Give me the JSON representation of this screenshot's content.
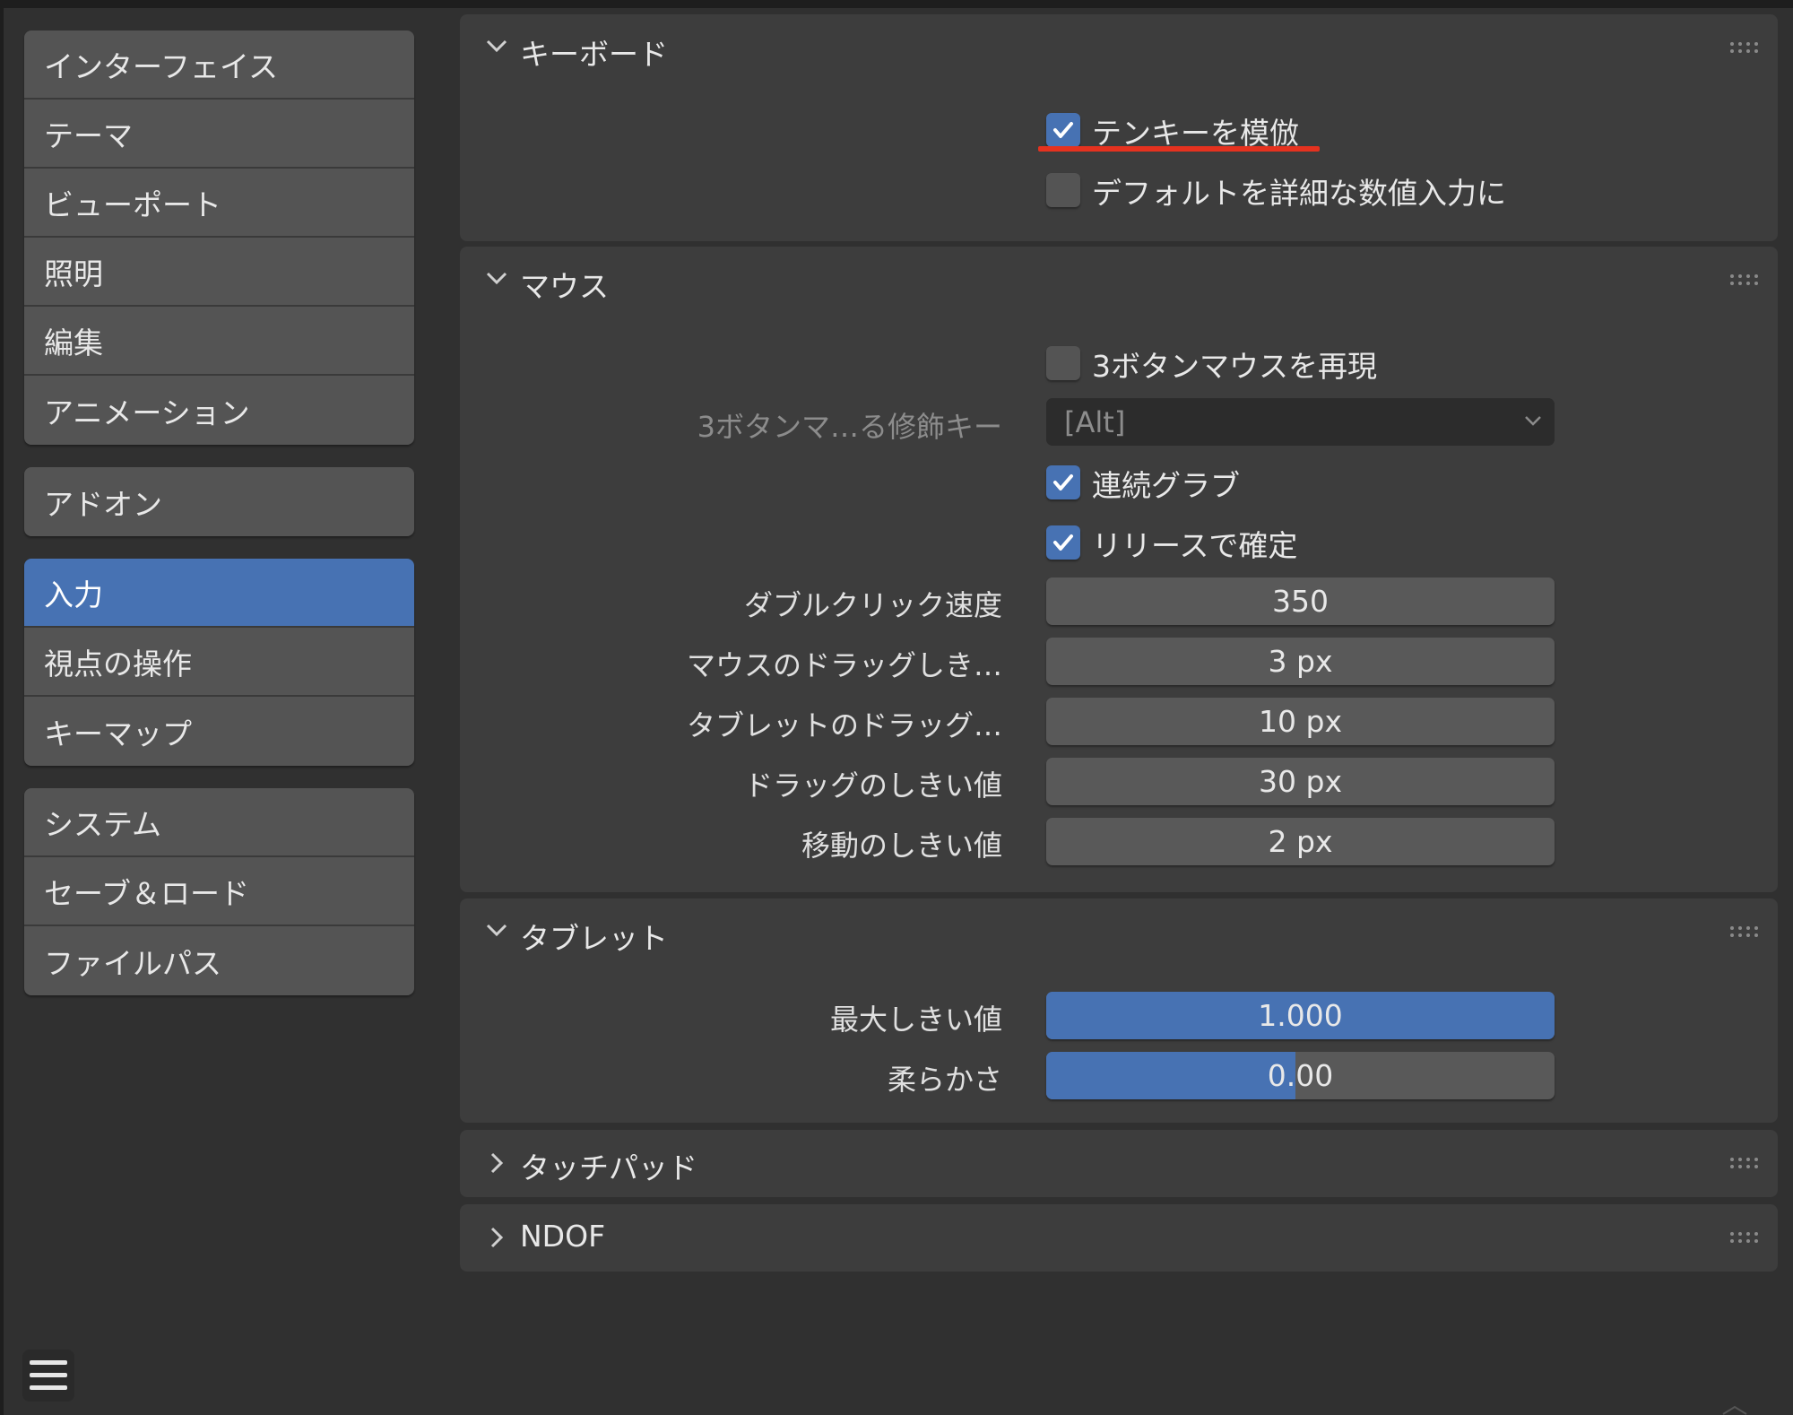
{
  "sidebar": {
    "groups": [
      [
        {
          "label": "インターフェイス",
          "active": false
        },
        {
          "label": "テーマ",
          "active": false
        },
        {
          "label": "ビューポート",
          "active": false
        },
        {
          "label": "照明",
          "active": false
        },
        {
          "label": "編集",
          "active": false
        },
        {
          "label": "アニメーション",
          "active": false
        }
      ],
      [
        {
          "label": "アドオン",
          "active": false
        }
      ],
      [
        {
          "label": "入力",
          "active": true
        },
        {
          "label": "視点の操作",
          "active": false
        },
        {
          "label": "キーマップ",
          "active": false
        }
      ],
      [
        {
          "label": "システム",
          "active": false
        },
        {
          "label": "セーブ＆ロード",
          "active": false
        },
        {
          "label": "ファイルパス",
          "active": false
        }
      ]
    ]
  },
  "keyboard": {
    "title": "キーボード",
    "emulate_numpad": {
      "label": "テンキーを模倣",
      "checked": true
    },
    "default_detailed_numeric": {
      "label": "デフォルトを詳細な数値入力に",
      "checked": false
    }
  },
  "mouse": {
    "title": "マウス",
    "emulate_3_button": {
      "label": "3ボタンマウスを再現",
      "checked": false
    },
    "emulate_modifier": {
      "label": "3ボタンマ…る修飾キー",
      "value": "[Alt]"
    },
    "continuous_grab": {
      "label": "連続グラブ",
      "checked": true
    },
    "release_confirm": {
      "label": "リリースで確定",
      "checked": true
    },
    "double_click": {
      "label": "ダブルクリック速度",
      "value": "350"
    },
    "mouse_drag": {
      "label": "マウスのドラッグしき…",
      "value": "3 px"
    },
    "tablet_drag": {
      "label": "タブレットのドラッグ…",
      "value": "10 px"
    },
    "drag_threshold": {
      "label": "ドラッグのしきい値",
      "value": "30 px"
    },
    "move_threshold": {
      "label": "移動のしきい値",
      "value": "2 px"
    }
  },
  "tablet": {
    "title": "タブレット",
    "max_threshold": {
      "label": "最大しきい値",
      "value": "1.000",
      "fill_fraction": 1.0
    },
    "softness": {
      "label": "柔らかさ",
      "value": "0.00",
      "fill_fraction": 0.49
    }
  },
  "touchpad": {
    "title": "タッチパッド"
  },
  "ndof": {
    "title": "NDOF"
  },
  "colors": {
    "accent": "#4772b3",
    "highlight": "#e5321f",
    "panel": "#3d3d3d",
    "background": "#303030"
  }
}
